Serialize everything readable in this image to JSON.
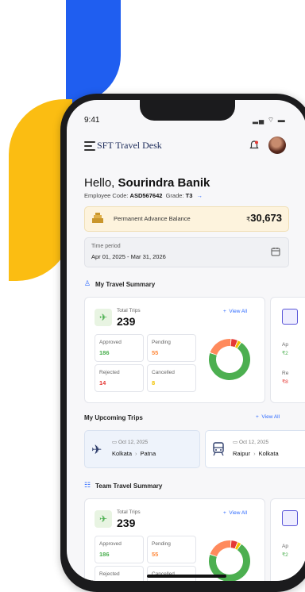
{
  "status_bar": {
    "time": "9:41",
    "icons": "▂▄ ⌔ ▬"
  },
  "header": {
    "app_title": "SFT Travel Desk"
  },
  "greeting": {
    "hello": "Hello,",
    "name": "Sourindra Banik",
    "employee_code_label": "Employee Code:",
    "employee_code": "ASD567642",
    "grade_label": "Grade:",
    "grade": "T3"
  },
  "advance": {
    "label": "Permanent Advance Balance",
    "currency": "₹",
    "amount": "30,673"
  },
  "period": {
    "label": "Time period",
    "value": "Apr 01, 2025 - Mar 31, 2026"
  },
  "my_travel_summary": {
    "title": "My Travel Summary",
    "total_trips_label": "Total Trips",
    "total_trips": "239",
    "view_all": "View All",
    "stats": [
      {
        "label": "Approved",
        "value": "186",
        "color": "#4caf50"
      },
      {
        "label": "Pending",
        "value": "55",
        "color": "#ff8a3d"
      },
      {
        "label": "Rejected",
        "value": "14",
        "color": "#e53935"
      },
      {
        "label": "Cancelled",
        "value": "8",
        "color": "#f2c200"
      }
    ],
    "donut": [
      {
        "name": "Approved",
        "value": 186,
        "color": "#4caf50"
      },
      {
        "name": "Pending",
        "value": 55,
        "color": "#ff8a5c"
      },
      {
        "name": "Rejected",
        "value": 14,
        "color": "#e53935"
      },
      {
        "name": "Cancelled",
        "value": 8,
        "color": "#f2c200"
      }
    ],
    "peek_stats": [
      "Ap",
      "₹2",
      "Re",
      "₹8"
    ]
  },
  "upcoming": {
    "title": "My Upcoming Trips",
    "view_all": "View All",
    "trips": [
      {
        "date": "Oct 12, 2025",
        "from": "Kolkata",
        "to": "Patna",
        "icon": "flight-icon"
      },
      {
        "date": "Oct 12, 2025",
        "from": "Raipur",
        "to": "Kolkata",
        "icon": "train-icon"
      }
    ]
  },
  "team_travel_summary": {
    "title": "Team Travel Summary",
    "total_trips_label": "Total Trips",
    "total_trips": "239",
    "view_all": "View All",
    "stats": [
      {
        "label": "Approved",
        "value": "186",
        "color": "#4caf50"
      },
      {
        "label": "Pending",
        "value": "55",
        "color": "#ff8a3d"
      },
      {
        "label": "Rejected",
        "value": "",
        "color": "#e53935"
      },
      {
        "label": "Cancelled",
        "value": "",
        "color": "#f2c200"
      }
    ],
    "peek_stats": [
      "Ap",
      "₹2"
    ]
  },
  "colors": {
    "blue": "#1f5ef0",
    "yellow": "#fbbd12",
    "accent": "#2f6bff"
  }
}
